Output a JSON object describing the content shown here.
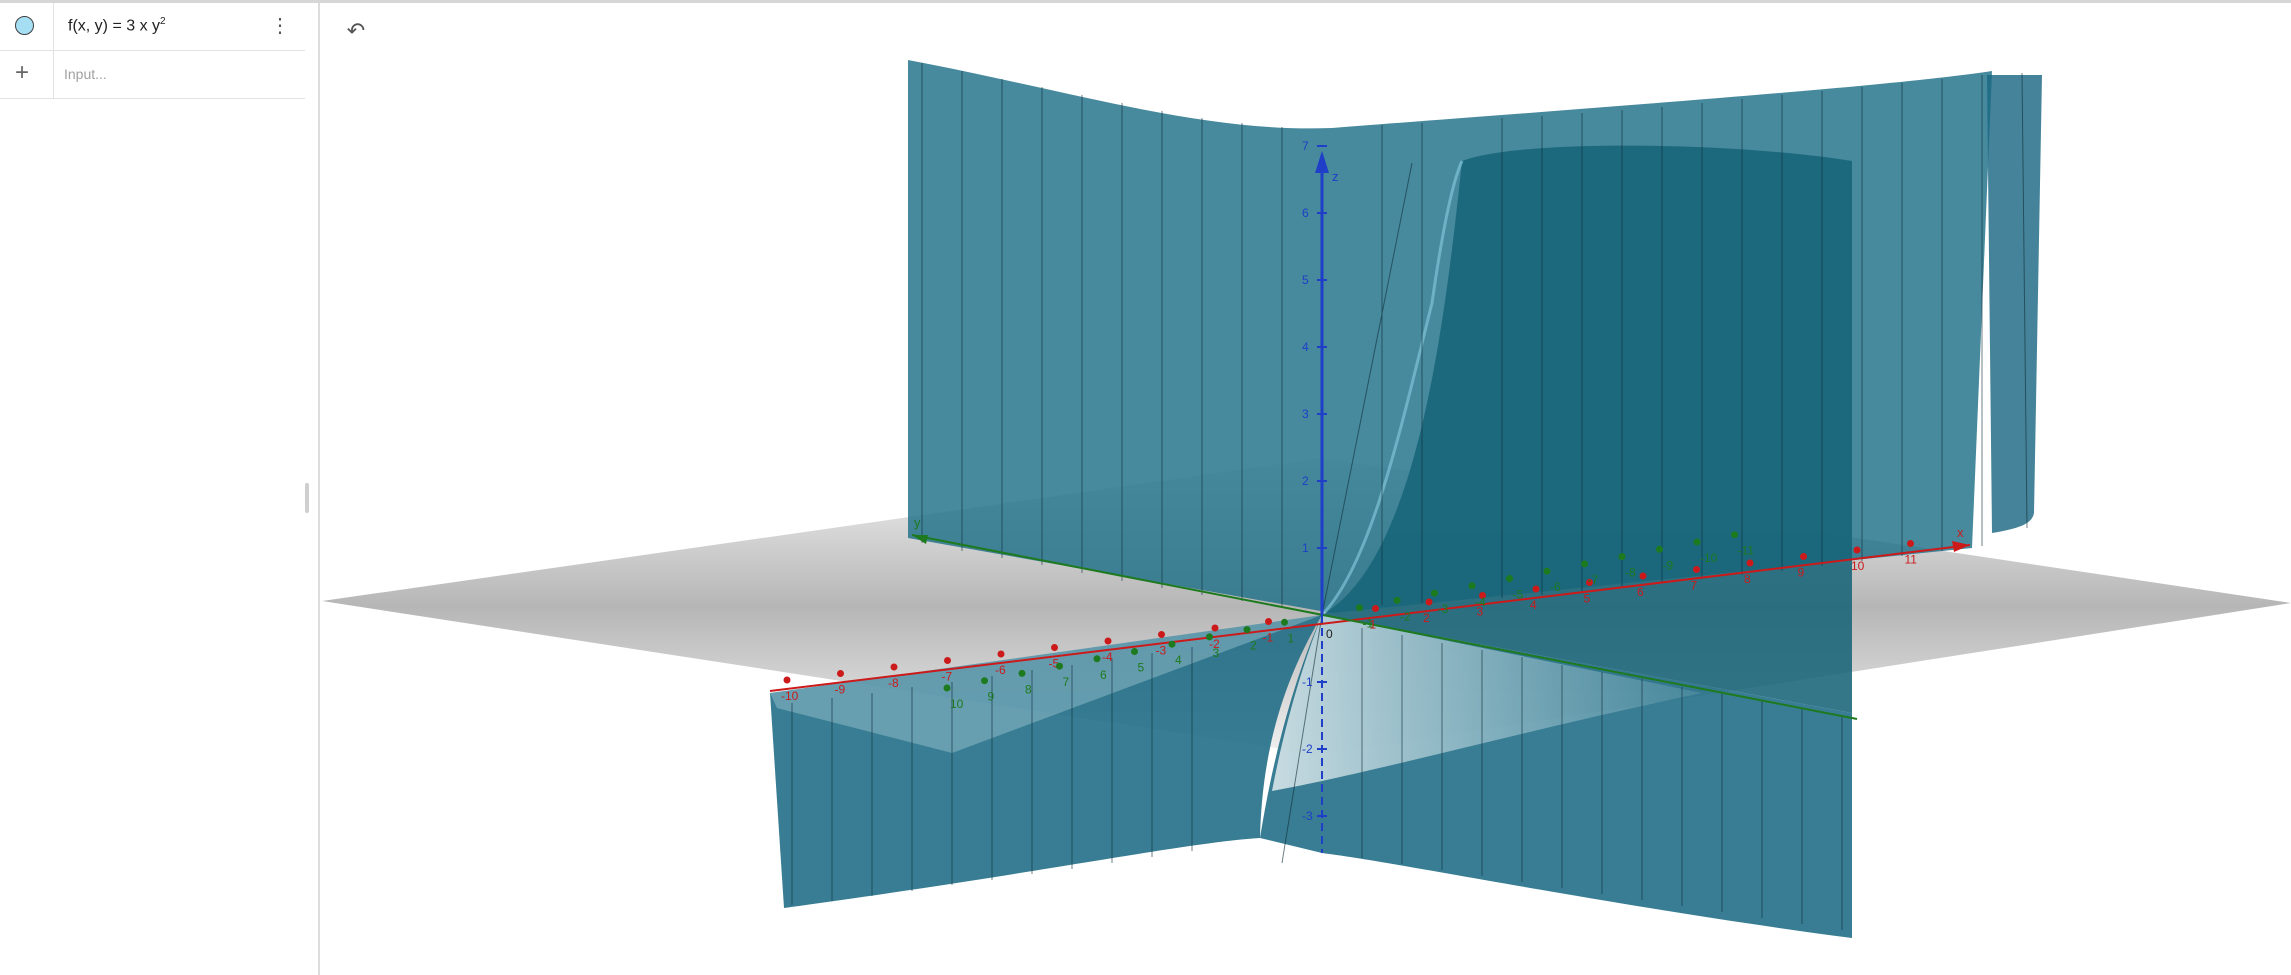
{
  "algebra": {
    "expression_prefix": "f(x, y)  =  3 x y",
    "expression_exponent": "2",
    "marble_color": "#a6def4",
    "menu_icon": "more-vertical-icon",
    "add_icon": "plus-icon",
    "input_placeholder": "Input..."
  },
  "toolbar": {
    "undo_icon": "undo-icon"
  },
  "axes": {
    "x_label": "x",
    "y_label": "y",
    "z_label": "z",
    "origin_label": "0",
    "x_ticks": [
      "-10",
      "-9",
      "-8",
      "-7",
      "-6",
      "-5",
      "-4",
      "-3",
      "-2",
      "-1",
      "1",
      "2",
      "3",
      "4",
      "5",
      "6",
      "7",
      "8",
      "9",
      "10",
      "11"
    ],
    "y_ticks": [
      "-11",
      "-10",
      "-9",
      "-8",
      "-7",
      "-6",
      "-5",
      "-4",
      "-3",
      "-2",
      "-1",
      "1",
      "2",
      "3",
      "4",
      "5",
      "6",
      "7",
      "8",
      "9",
      "10"
    ],
    "z_ticks": [
      "-3",
      "-2",
      "-1",
      "1",
      "2",
      "3",
      "4",
      "5",
      "6",
      "7"
    ],
    "x_color": "#cc1a1a",
    "y_color": "#1e7a1e",
    "z_color": "#1f3fc8"
  },
  "surface": {
    "color": "#1e6f88",
    "function": "f(x, y) = 3 x y^2"
  }
}
